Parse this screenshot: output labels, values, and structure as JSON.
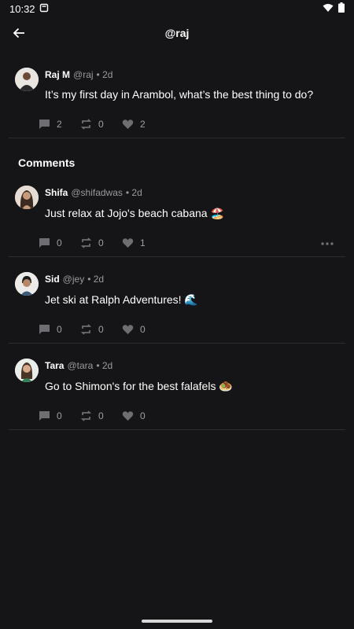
{
  "status_bar": {
    "time": "10:32"
  },
  "header": {
    "title": "@raj"
  },
  "post": {
    "name": "Raj M",
    "handle": "@raj",
    "time": "• 2d",
    "text": "It’s my first day in Arambol, what’s the best thing to do?",
    "comments": "2",
    "reposts": "0",
    "likes": "2"
  },
  "comments_section": {
    "title": "Comments"
  },
  "comments": [
    {
      "name": "Shifa",
      "handle": "@shifadwas",
      "time": "• 2d",
      "text": "Just relax at Jojo's beach cabana 🏖️",
      "comments": "0",
      "reposts": "0",
      "likes": "1"
    },
    {
      "name": "Sid",
      "handle": "@jey",
      "time": "• 2d",
      "text": "Jet ski at Ralph Adventures!  🌊",
      "comments": "0",
      "reposts": "0",
      "likes": "0"
    },
    {
      "name": "Tara",
      "handle": "@tara",
      "time": "• 2d",
      "text": "Go to Shimon's for the best falafels 🧆",
      "comments": "0",
      "reposts": "0",
      "likes": "0"
    }
  ],
  "colors": {
    "background": "#151517",
    "muted": "#9a9a9e",
    "divider": "#2c2c30"
  }
}
